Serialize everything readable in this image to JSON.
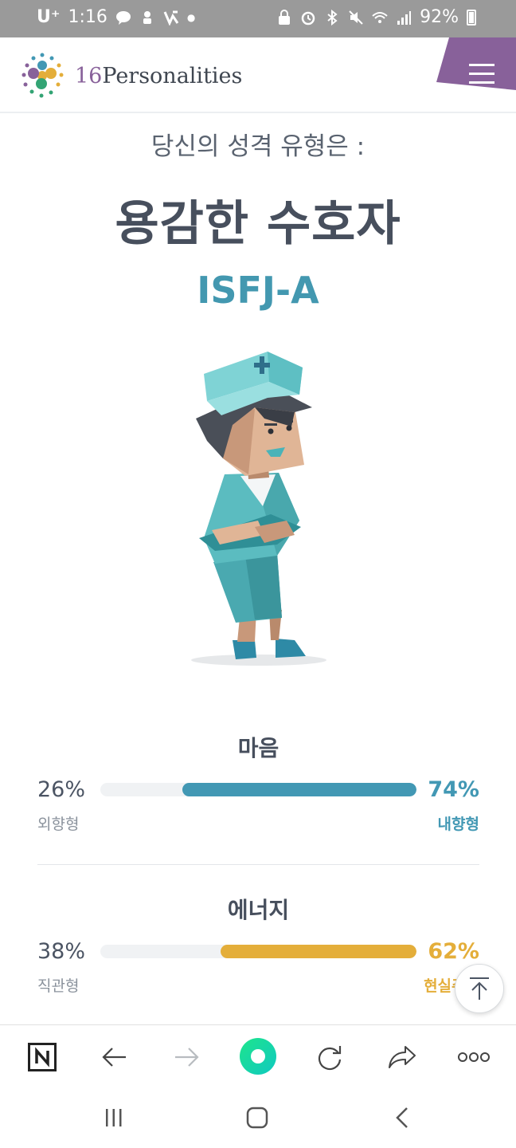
{
  "status_bar": {
    "carrier": "U⁺",
    "time": "1:16",
    "battery": "92%"
  },
  "header": {
    "logo_number": "16",
    "logo_text": "Personalities"
  },
  "result": {
    "intro": "당신의 성격 유형은 :",
    "type_name": "용감한 수호자",
    "type_code": "ISFJ-A"
  },
  "traits": [
    {
      "title": "마음",
      "left_percent": "26%",
      "right_percent": "74%",
      "left_label": "외향형",
      "right_label": "내향형",
      "fill_fraction": 0.74,
      "color": "#4298b4"
    },
    {
      "title": "에너지",
      "left_percent": "38%",
      "right_percent": "62%",
      "left_label": "직관형",
      "right_label": "현실주의",
      "fill_fraction": 0.62,
      "color": "#e4ae3a"
    }
  ],
  "colors": {
    "brand_purple": "#88619a",
    "teal": "#4298b4",
    "gold": "#e4ae3a"
  },
  "icons": {
    "menu": "hamburger-icon",
    "scroll_top": "arrow-up-icon",
    "home": "naver-n-icon",
    "back": "arrow-left-icon",
    "forward": "arrow-right-icon",
    "green_dot": "green-dot-icon",
    "reload": "reload-icon",
    "share": "share-icon",
    "more": "more-icon"
  }
}
